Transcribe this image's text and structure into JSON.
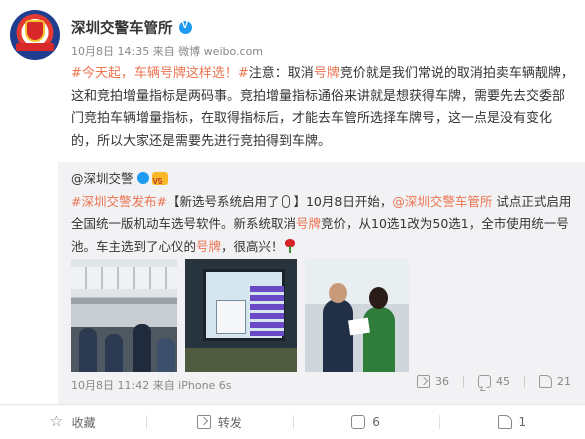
{
  "header": {
    "name": "深圳交警车管所",
    "meta": "10月8日 14:35 来自 微博 weibo.com"
  },
  "post": {
    "segments": [
      {
        "text": "#今天起，车辆号牌这样选！#",
        "highlight": true
      },
      {
        "text": "注意：取消",
        "highlight": false
      },
      {
        "text": "号牌",
        "highlight": true
      },
      {
        "text": "竞价就是我们常说的取消拍卖车辆靓牌，这和竞拍增量指标是两码事。竞拍增量指标通俗来讲就是想获得车牌，需要先去交委部门竞拍车辆增量指标，在取得指标后，才能去车管所选择车牌号，这一点是没有变化的，所以大家还是需要先进行竞拍得到车牌。",
        "highlight": false
      }
    ]
  },
  "repost": {
    "author": "@深圳交警",
    "line_tag": "#深圳交警发布#",
    "line_a": "【新选号系统启用了",
    "line_b": "】10月8日开始，",
    "mention": "@深圳交警车管所",
    "line_c": "试点正式启用全国统一版机动车选号软件。新系统取消",
    "hl1": "号牌",
    "line_d": "竞价，从10选1改为50选1，全市使用统一号池。车主选到了心仪的",
    "hl2": "号牌",
    "line_e": "，很高兴！",
    "meta": "10月8日 11:42 来自 iPhone 6s",
    "forward_count": "36",
    "comment_count": "45",
    "like_count": "21"
  },
  "actions": {
    "favorite": "收藏",
    "forward": "转发",
    "comment": "6",
    "like": "1"
  },
  "colors": {
    "highlight": "#eb7350",
    "repost_bg": "#f2f2f5",
    "verified": "#1d9bf0"
  },
  "icons": [
    "verified-icon",
    "mic-icon",
    "rose-emoji-icon",
    "forward-icon",
    "comment-icon",
    "like-icon",
    "star-icon",
    "share-icon"
  ]
}
